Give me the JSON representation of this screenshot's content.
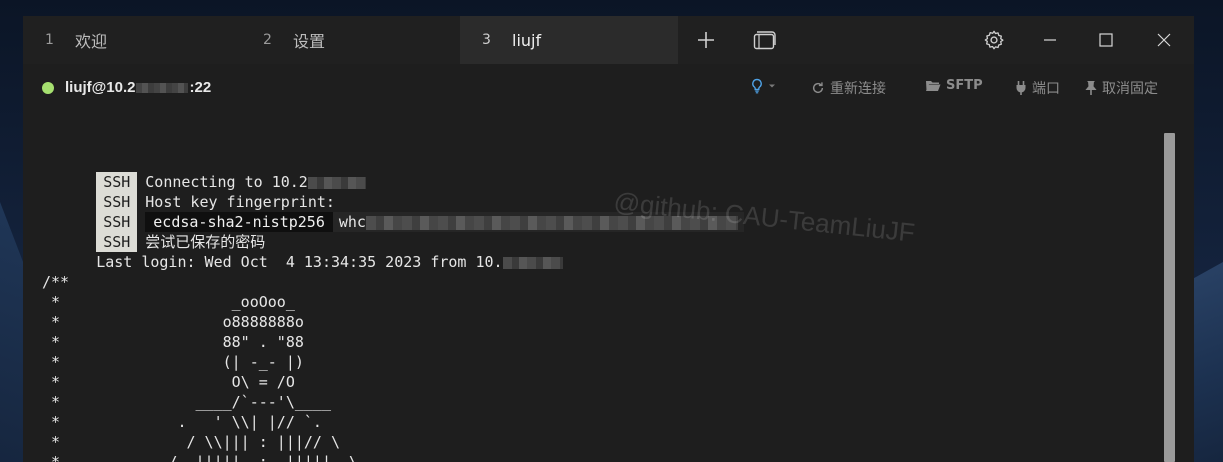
{
  "tabs": [
    {
      "num": "1",
      "label": "欢迎"
    },
    {
      "num": "2",
      "label": "设置"
    },
    {
      "num": "3",
      "label": "liujf"
    }
  ],
  "connection": {
    "prefix": "liujf@10.2",
    "suffix": ":22",
    "status_color": "#a6e070"
  },
  "toolbar": {
    "reconnect": "重新连接",
    "sftp": "SFTP",
    "port": "端口",
    "unpin": "取消固定"
  },
  "terminal": {
    "ssh_tag": "SSH",
    "line1": "Connecting to 10.2",
    "line2": "Host key fingerprint:",
    "algo": "ecdsa-sha2-nistp256",
    "fp_prefix": "whc",
    "line4": "尝试已保存的密码",
    "last_login": "Last login: Wed Oct  4 13:34:35 2023 from 10.",
    "art": [
      "/**",
      " *                   _ooOoo_",
      " *                  o8888888o",
      " *                  88\" . \"88",
      " *                  (| -_- |)",
      " *                   O\\ = /O",
      " *               ____/`---'\\____",
      " *             .   ' \\\\| |// `.",
      " *              / \\\\||| : |||// \\",
      " *            / _||||| -:- |||||- \\"
    ]
  },
  "watermark": "@github: CAU-TeamLiuJF"
}
